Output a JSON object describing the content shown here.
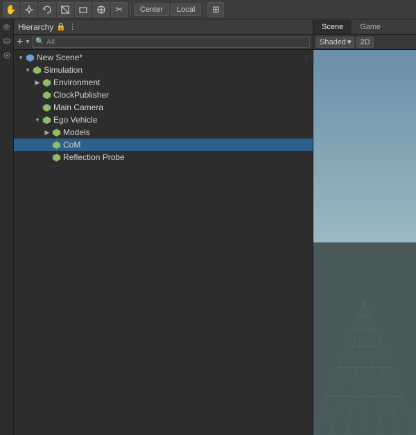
{
  "toolbar": {
    "icons": [
      "✋",
      "⊕",
      "↺",
      "⬛",
      "⬜",
      "⊗",
      "✂"
    ],
    "center_label": "Center",
    "local_label": "Local",
    "grid_icon": "⊞"
  },
  "hierarchy": {
    "panel_title": "Hierarchy",
    "search_placeholder": "All",
    "add_button": "+",
    "more_icon": "⋮",
    "items_icon": "≡",
    "tree": [
      {
        "id": "new-scene",
        "label": "New Scene*",
        "indent": 0,
        "has_arrow": true,
        "arrow_open": true,
        "icon": "scene",
        "selected": false
      },
      {
        "id": "simulation",
        "label": "Simulation",
        "indent": 1,
        "has_arrow": true,
        "arrow_open": true,
        "icon": "cube",
        "selected": false
      },
      {
        "id": "environment",
        "label": "Environment",
        "indent": 2,
        "has_arrow": true,
        "arrow_open": false,
        "icon": "cube",
        "selected": false
      },
      {
        "id": "clock-publisher",
        "label": "ClockPublisher",
        "indent": 2,
        "has_arrow": false,
        "icon": "cube",
        "selected": false
      },
      {
        "id": "main-camera",
        "label": "Main Camera",
        "indent": 2,
        "has_arrow": false,
        "icon": "cube",
        "selected": false
      },
      {
        "id": "ego-vehicle",
        "label": "Ego Vehicle",
        "indent": 2,
        "has_arrow": true,
        "arrow_open": true,
        "icon": "cube",
        "selected": false
      },
      {
        "id": "models",
        "label": "Models",
        "indent": 3,
        "has_arrow": true,
        "arrow_open": false,
        "icon": "cube",
        "selected": false
      },
      {
        "id": "com",
        "label": "CoM",
        "indent": 3,
        "has_arrow": false,
        "icon": "cube",
        "selected": true,
        "highlighted": true
      },
      {
        "id": "reflection-probe",
        "label": "Reflection Probe",
        "indent": 3,
        "has_arrow": false,
        "icon": "cube",
        "selected": false
      }
    ]
  },
  "scene": {
    "tab_scene": "Scene",
    "tab_game": "Game",
    "shaded_label": "Shaded",
    "two_d_label": "2D"
  }
}
